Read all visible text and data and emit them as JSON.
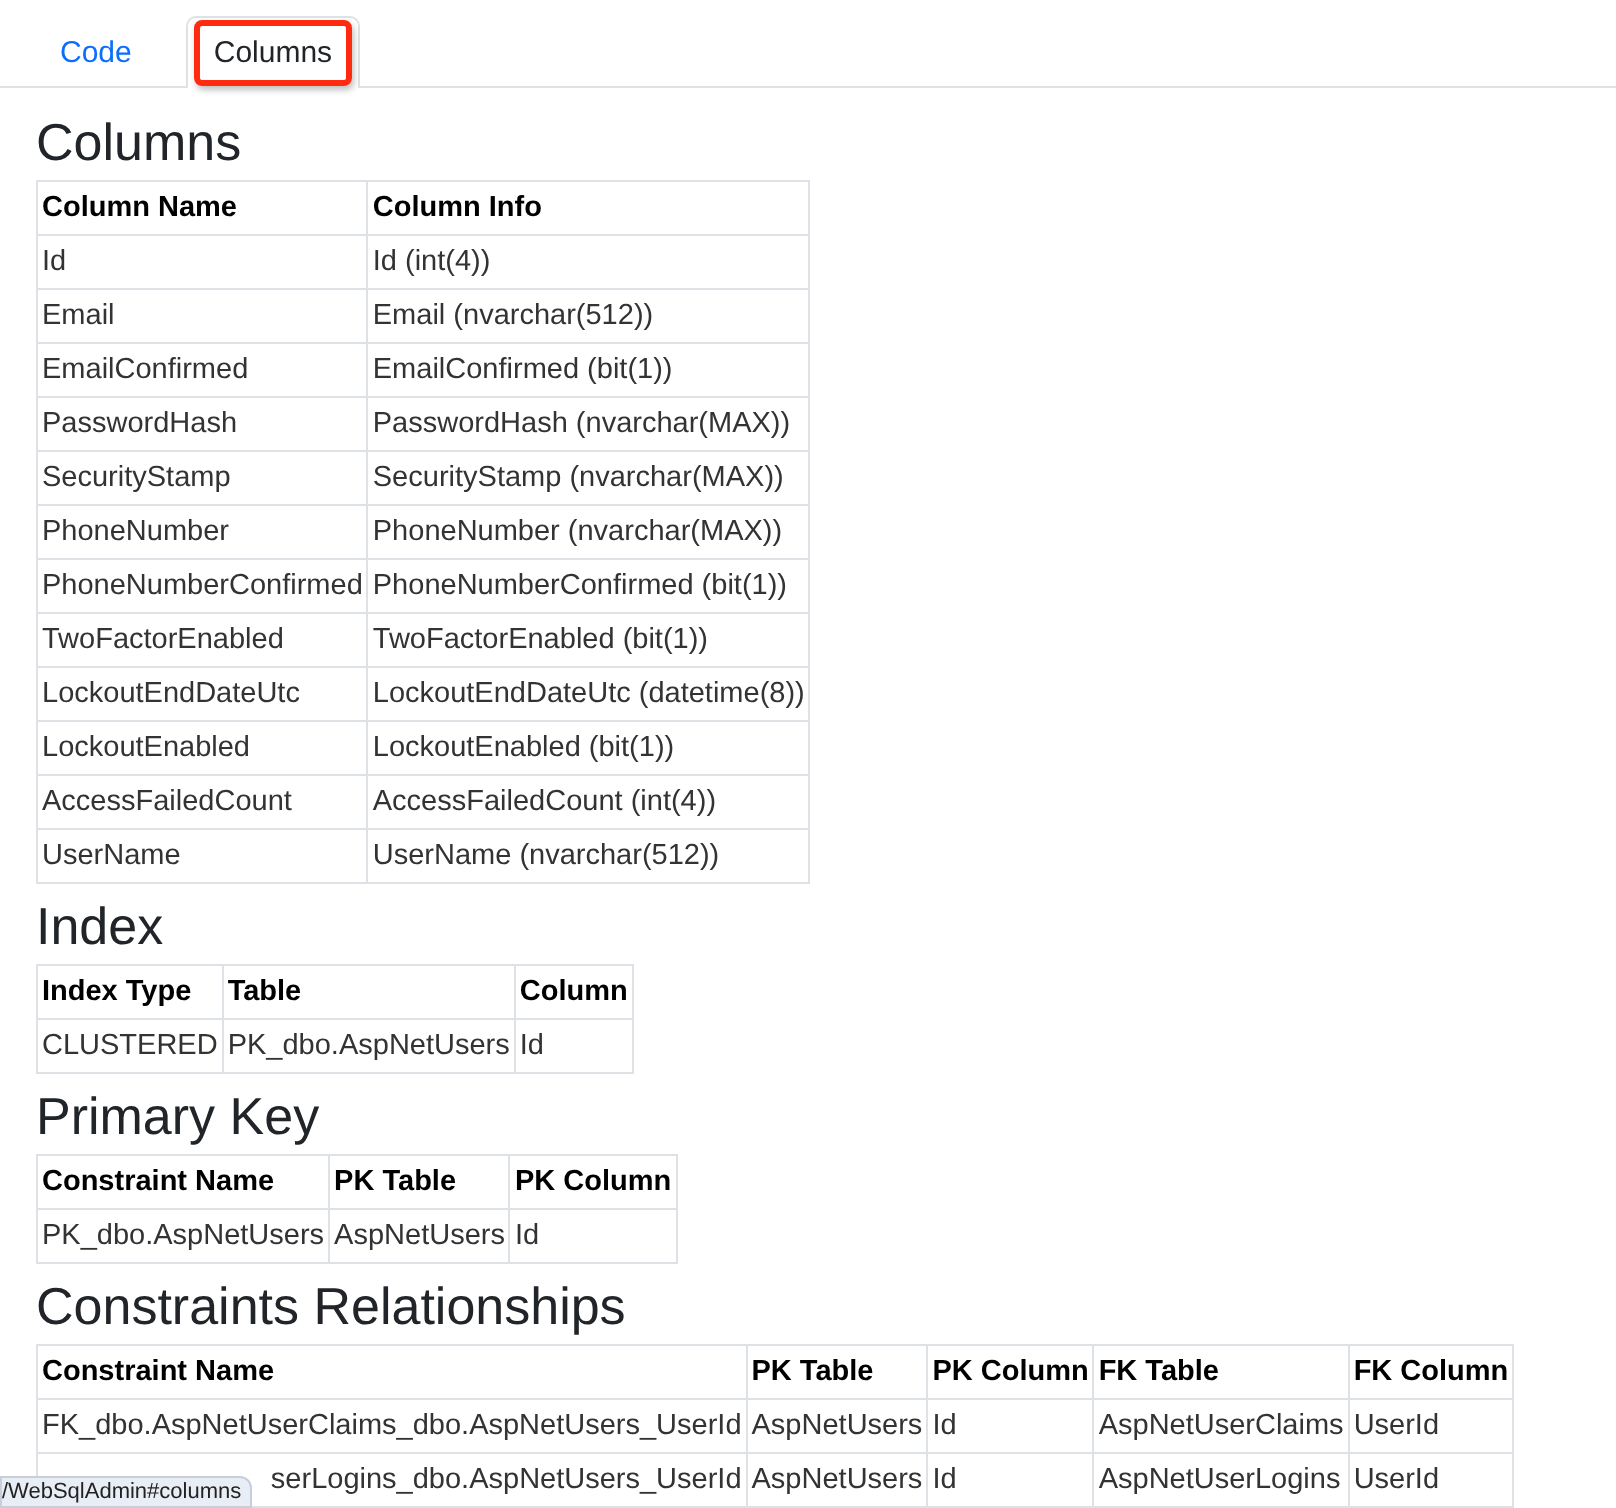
{
  "tabs": [
    {
      "label": "Code",
      "selected": false,
      "highlighted": false
    },
    {
      "label": "Columns",
      "selected": true,
      "highlighted": true
    }
  ],
  "sections": [
    {
      "title": "Columns",
      "columns": [
        "Column Name",
        "Column Info"
      ],
      "rows": [
        [
          "Id",
          "Id (int(4))"
        ],
        [
          "Email",
          "Email (nvarchar(512))"
        ],
        [
          "EmailConfirmed",
          "EmailConfirmed (bit(1))"
        ],
        [
          "PasswordHash",
          "PasswordHash (nvarchar(MAX))"
        ],
        [
          "SecurityStamp",
          "SecurityStamp (nvarchar(MAX))"
        ],
        [
          "PhoneNumber",
          "PhoneNumber (nvarchar(MAX))"
        ],
        [
          "PhoneNumberConfirmed",
          "PhoneNumberConfirmed (bit(1))"
        ],
        [
          "TwoFactorEnabled",
          "TwoFactorEnabled (bit(1))"
        ],
        [
          "LockoutEndDateUtc",
          "LockoutEndDateUtc (datetime(8))"
        ],
        [
          "LockoutEnabled",
          "LockoutEnabled (bit(1))"
        ],
        [
          "AccessFailedCount",
          "AccessFailedCount (int(4))"
        ],
        [
          "UserName",
          "UserName (nvarchar(512))"
        ]
      ]
    },
    {
      "title": "Index",
      "columns": [
        "Index Type",
        "Table",
        "Column"
      ],
      "rows": [
        [
          "CLUSTERED",
          "PK_dbo.AspNetUsers",
          "Id"
        ]
      ]
    },
    {
      "title": "Primary Key",
      "columns": [
        "Constraint Name",
        "PK Table",
        "PK Column"
      ],
      "rows": [
        [
          "PK_dbo.AspNetUsers",
          "AspNetUsers",
          "Id"
        ]
      ]
    },
    {
      "title": "Constraints Relationships",
      "columns": [
        "Constraint Name",
        "PK Table",
        "PK Column",
        "FK Table",
        "FK Column"
      ],
      "rows": [
        [
          "FK_dbo.AspNetUserClaims_dbo.AspNetUsers_UserId",
          "AspNetUsers",
          "Id",
          "AspNetUserClaims",
          "UserId"
        ],
        [
          "serLogins_dbo.AspNetUsers_UserId",
          "AspNetUsers",
          "Id",
          "AspNetUserLogins",
          "UserId"
        ]
      ]
    }
  ],
  "status_link": "/WebSqlAdmin#columns"
}
